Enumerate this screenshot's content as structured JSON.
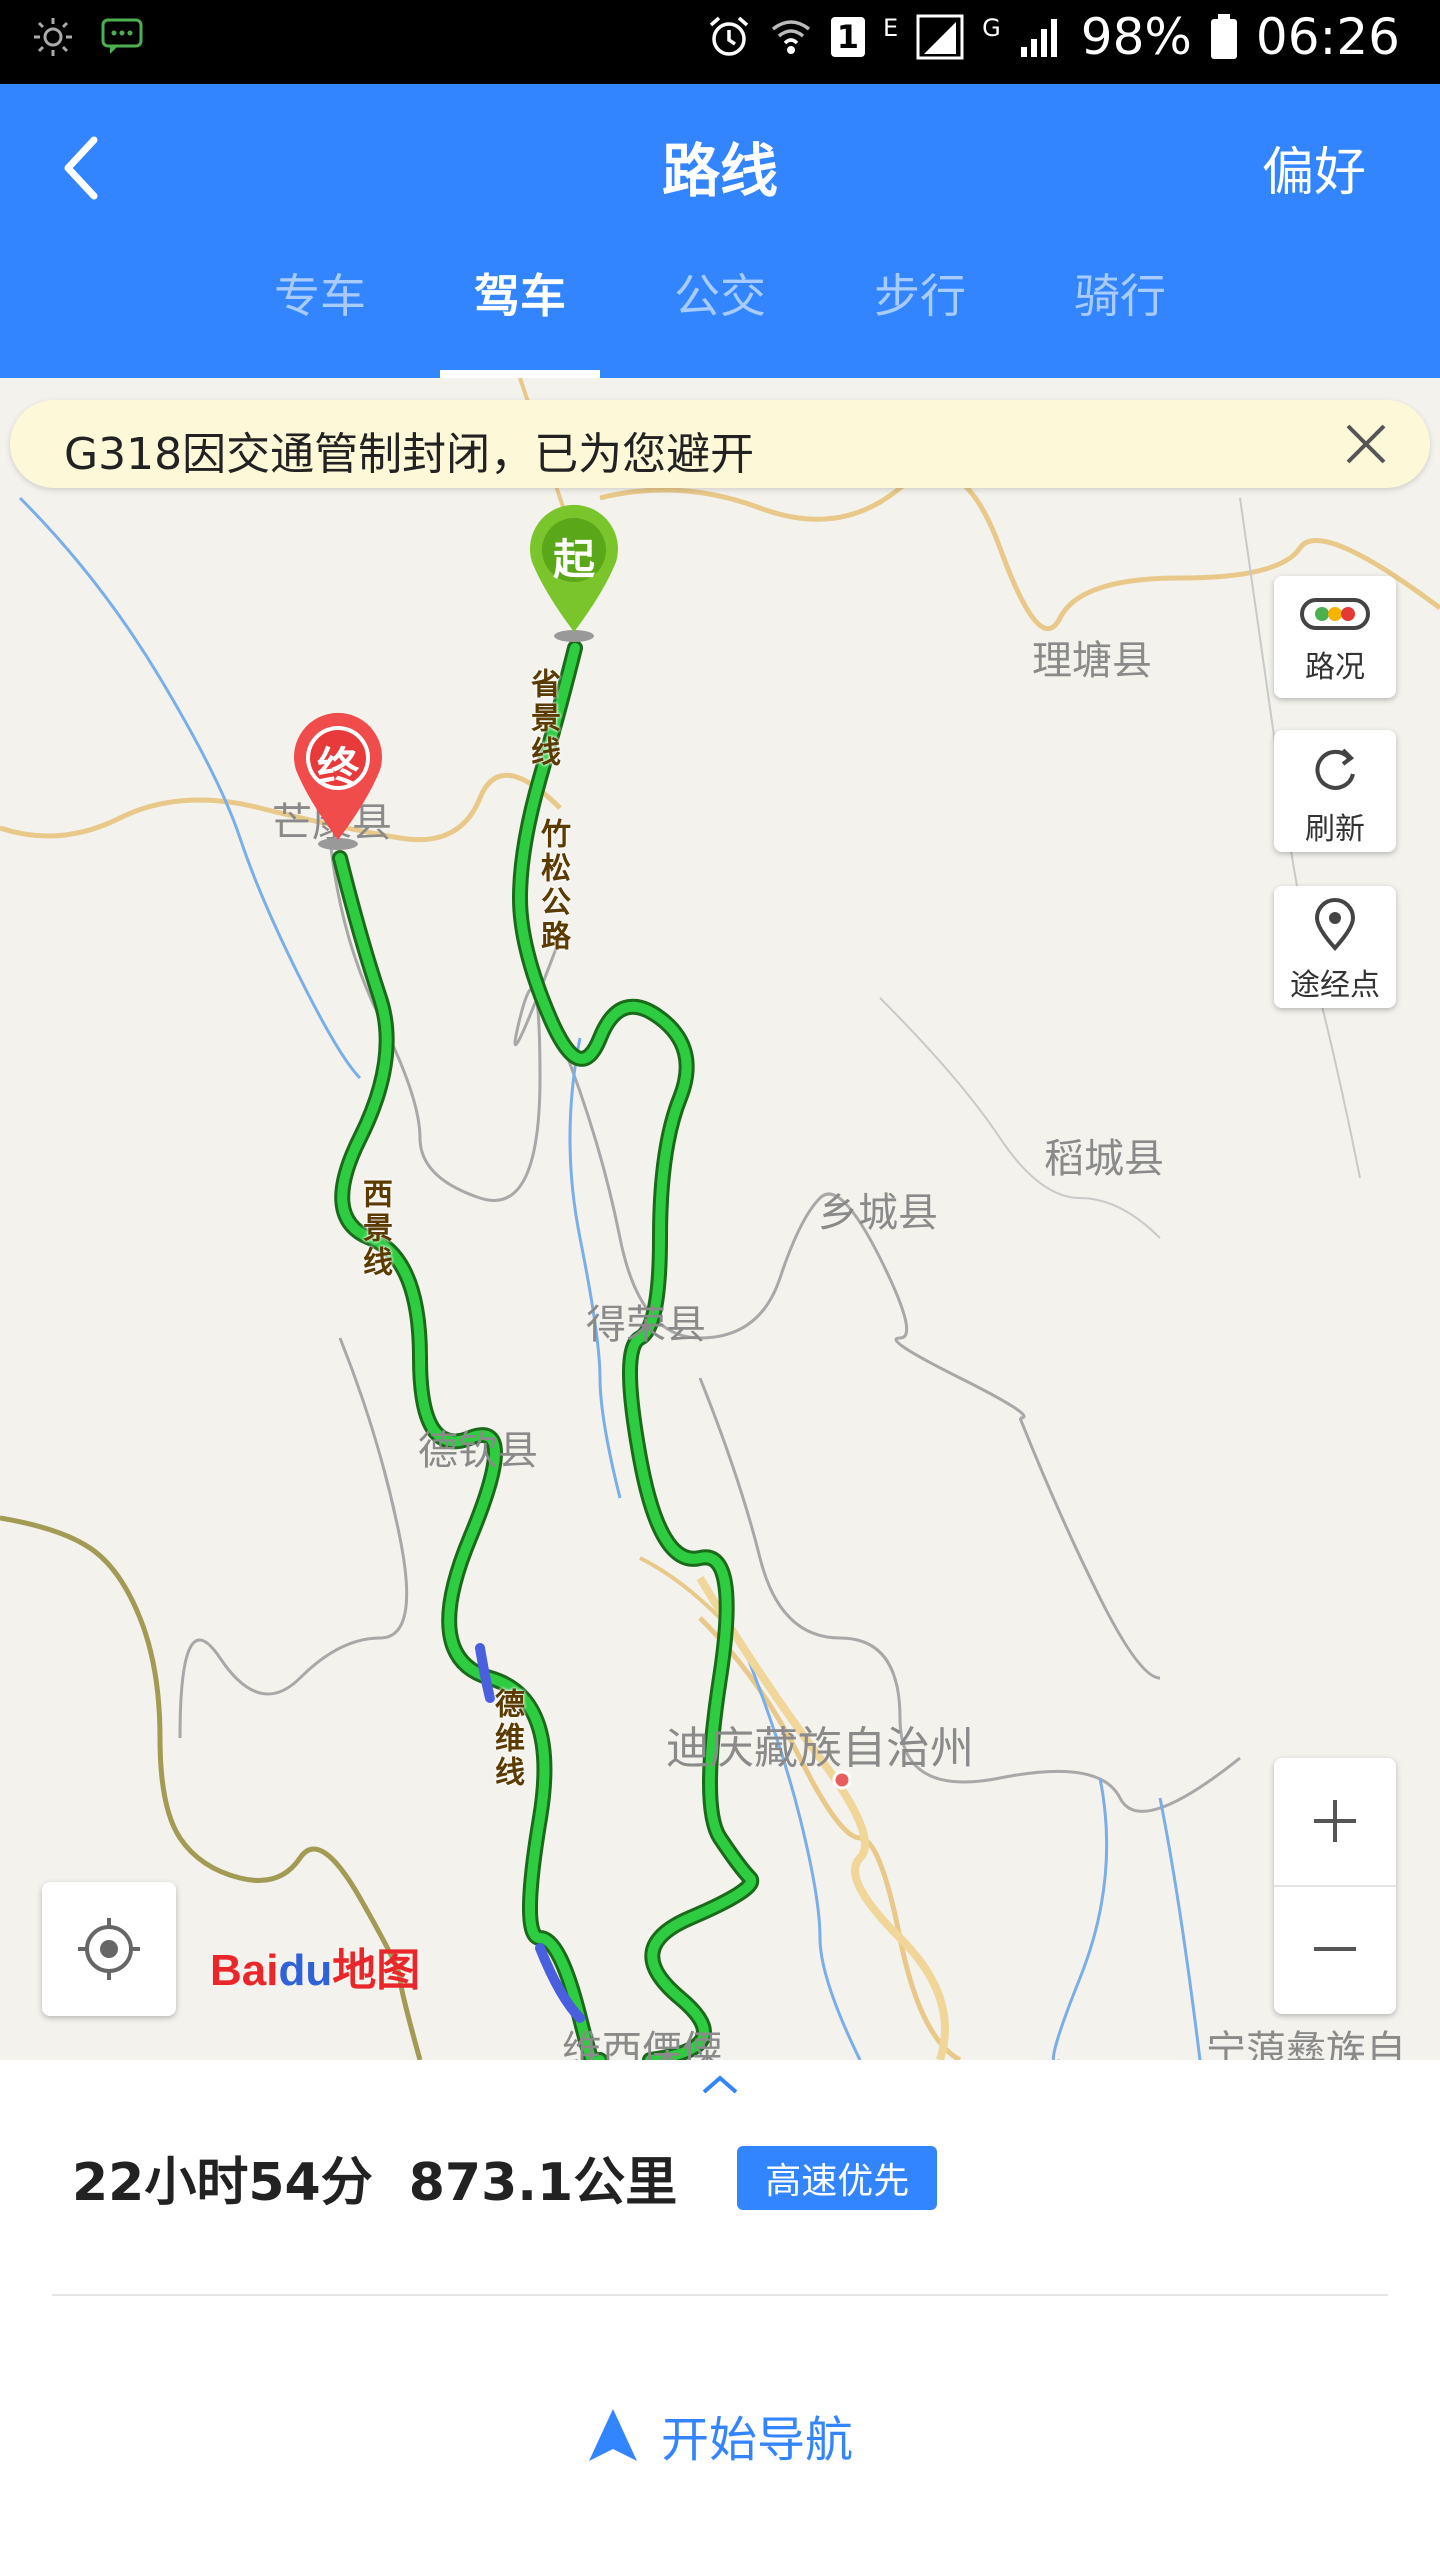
{
  "status_bar": {
    "battery": "98%",
    "time": "06:26",
    "sim_label": "1",
    "net1": "E",
    "net2": "G"
  },
  "header": {
    "title": "路线",
    "preference": "偏好",
    "tabs": [
      {
        "label": "专车",
        "active": false
      },
      {
        "label": "驾车",
        "active": true
      },
      {
        "label": "公交",
        "active": false
      },
      {
        "label": "步行",
        "active": false
      },
      {
        "label": "骑行",
        "active": false
      }
    ]
  },
  "map": {
    "notice": "G318因交通管制封闭，已为您避开",
    "controls": {
      "traffic": "路况",
      "refresh": "刷新",
      "waypoint": "途经点"
    },
    "start_marker": "起",
    "end_marker": "终",
    "places": {
      "litang": "理塘县",
      "mangkang": "芒康县",
      "daocheng": "稻城县",
      "xiangcheng": "乡城县",
      "derong": "得荣县",
      "deqin": "德钦县",
      "diqing": "迪庆藏族自治州",
      "weixi": "维西傈僳",
      "ninglang": "宁蒗彝族自"
    },
    "roads": {
      "road1": "省景线",
      "road2": "竹松公路",
      "road3": "西景线",
      "road4": "德维线"
    },
    "logo_bai": "Bai",
    "logo_du": "du",
    "logo_map": "地图",
    "colors": {
      "route": "#2ba52b",
      "route_slow": "#4a5ee0",
      "accent": "#3385ff"
    }
  },
  "route": {
    "duration": "22小时54分",
    "distance": "873.1公里",
    "strategy": "高速优先",
    "navigate": "开始导航"
  }
}
